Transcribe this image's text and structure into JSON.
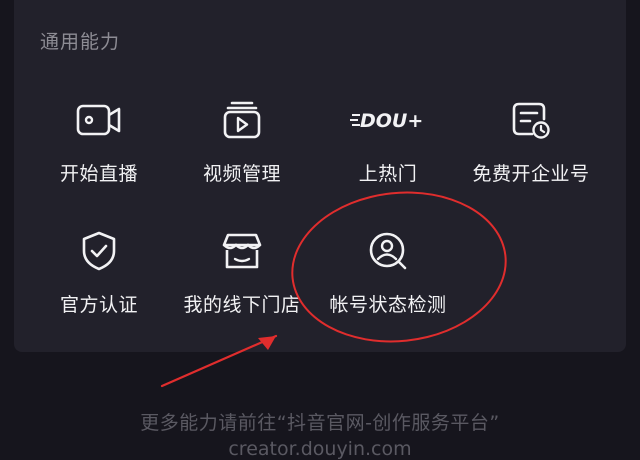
{
  "section": {
    "title": "通用能力"
  },
  "items": [
    {
      "label": "开始直播",
      "icon": "live-camera-icon"
    },
    {
      "label": "视频管理",
      "icon": "video-manage-icon"
    },
    {
      "label": "上热门",
      "icon": "dou-plus-logo",
      "logo_text": "DOU+"
    },
    {
      "label": "免费开企业号",
      "icon": "enterprise-account-icon"
    },
    {
      "label": "官方认证",
      "icon": "shield-check-icon"
    },
    {
      "label": "我的线下门店",
      "icon": "store-icon"
    },
    {
      "label": "帐号状态检测",
      "icon": "account-check-icon"
    }
  ],
  "footer": {
    "line1": "更多能力请前往“抖音官网-创作服务平台”",
    "line2": "creator.douyin.com"
  },
  "colors": {
    "background": "#16151d",
    "panel": "#22212b",
    "text": "#f2f2f4",
    "muted": "#8d8c94",
    "annotation": "#e02d2d"
  }
}
